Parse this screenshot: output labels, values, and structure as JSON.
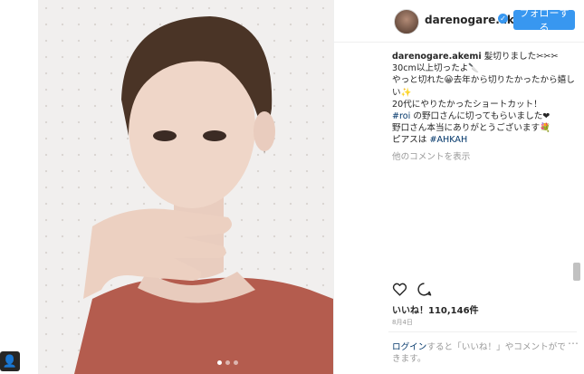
{
  "post": {
    "username": "darenogare.akemi",
    "follow_label": "フォローする",
    "caption_lines": [
      "髪切りました✂✂✂",
      "30cm以上切ったよ🔪",
      "やっと切れた😀去年から切りたかったから嬉しい✨",
      "20代にやりたかったショートカット！"
    ],
    "caption_tag1": "#roi",
    "caption_line5_rest": " の野口さんに切ってもらいました❤",
    "caption_line6": "野口さん本当にありがとうございます💐",
    "caption_line7_prefix": "ピアスは ",
    "caption_tag2": "#AHKAH",
    "more_comments": "他のコメントを表示",
    "likes": "いいね！110,146件",
    "date": "8月4日",
    "login_link": "ログイン",
    "login_rest": "すると「いいね！」やコメントができます。",
    "more_icon": "⋯",
    "dots_total": 3,
    "dots_active": 1
  },
  "icons": {
    "heart": "heart-icon",
    "comment": "comment-icon",
    "user": "user-icon",
    "verified": "verified-badge-icon"
  },
  "colors": {
    "accent": "#3897f0",
    "hashtag": "#003569"
  }
}
